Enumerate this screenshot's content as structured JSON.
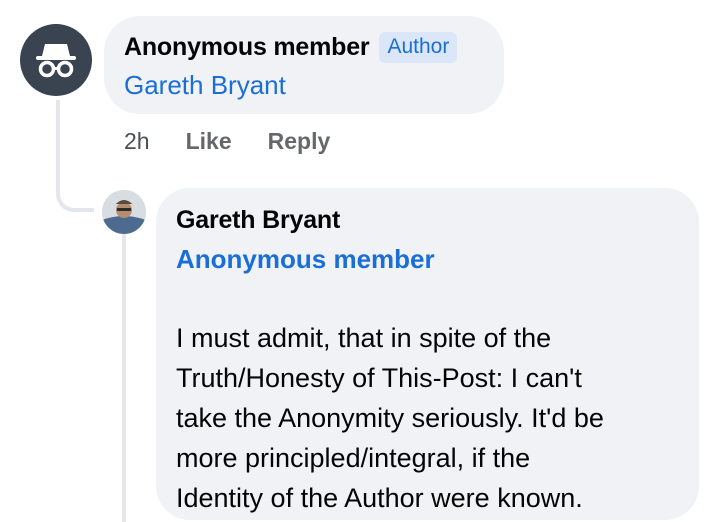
{
  "comment": {
    "author_name": "Anonymous member",
    "author_badge": "Author",
    "tagged_name": "Gareth Bryant",
    "avatar_icon": "incognito-icon",
    "actions": {
      "time": "2h",
      "like_label": "Like",
      "reply_label": "Reply"
    }
  },
  "reply": {
    "author_name": "Gareth Bryant",
    "tagged_name": "Anonymous member",
    "body": "I must admit, that in spite of the\nTruth/Honesty of This-Post: I can't\ntake the Anonymity seriously. It'd be\nmore principled/integral, if the\nIdentity of the Author were known.",
    "avatar_icon": "profile-photo"
  },
  "colors": {
    "link_blue": "#1a6ed8",
    "bubble_bg": "#f0f2f5",
    "badge_bg": "#dbe7f9",
    "anon_avatar_bg": "#3a4450"
  }
}
